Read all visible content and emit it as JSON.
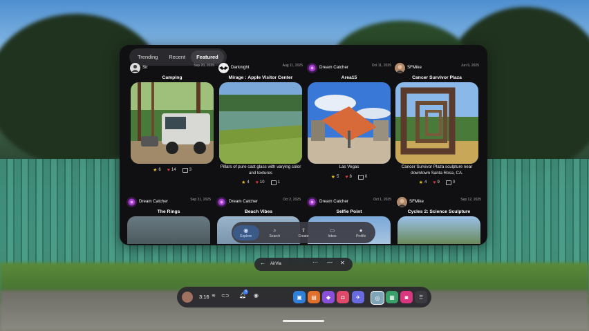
{
  "tabs": [
    {
      "label": "Trending"
    },
    {
      "label": "Recent"
    },
    {
      "label": "Featured"
    }
  ],
  "posts": [
    {
      "user": "Sir",
      "date": "Sep 20, 2025",
      "title": "Camping",
      "caption": "",
      "stars": "6",
      "likes": "14",
      "comments": "3"
    },
    {
      "user": "Darknight",
      "date": "Aug 11, 2025",
      "title": "Mirage : Apple Visitor Center",
      "caption": "Pillars of pure cast glass with varying color and textures",
      "stars": "4",
      "likes": "10",
      "comments": "1"
    },
    {
      "user": "Dream Catcher",
      "date": "Oct 11, 2025",
      "title": "Area15",
      "caption": "Las Vegas",
      "stars": "5",
      "likes": "8",
      "comments": "0"
    },
    {
      "user": "SFMike",
      "date": "Jun 9, 2025",
      "title": "Cancer Survivor Plaza",
      "caption": "Cancer Survivor Plaza sculpture near downtown Santa Rosa, CA.",
      "stars": "4",
      "likes": "9",
      "comments": "0"
    },
    {
      "user": "Dream Catcher",
      "date": "Sep 21, 2025",
      "title": "The Rings"
    },
    {
      "user": "Dream Catcher",
      "date": "Oct 2, 2025",
      "title": "Beach Vibes"
    },
    {
      "user": "Dream Catcher",
      "date": "Oct 1, 2025",
      "title": "Selfie Point"
    },
    {
      "user": "SFMike",
      "date": "Sep 12, 2025",
      "title": "Cycles 2: Science Sculpture"
    }
  ],
  "bottom_nav": [
    {
      "label": "Explore",
      "icon": "compass-icon"
    },
    {
      "label": "Search",
      "icon": "search-icon"
    },
    {
      "label": "Create",
      "icon": "share-icon"
    },
    {
      "label": "Inbox",
      "icon": "inbox-icon"
    },
    {
      "label": "Profile",
      "icon": "person-icon"
    }
  ],
  "titlebar": {
    "app_name": "AirVia"
  },
  "taskbar": {
    "time": "3:16",
    "notification_count": "3",
    "apps": [
      {
        "icon": "gallery-icon",
        "color": "#2f7fd6"
      },
      {
        "icon": "store-icon",
        "color": "#e0702a"
      },
      {
        "icon": "chat-icon",
        "color": "#8a4fd8"
      },
      {
        "icon": "camera-icon",
        "color": "#e04a6a"
      },
      {
        "icon": "messenger-icon",
        "color": "#6a6ae0"
      },
      {
        "icon": "airvia-icon",
        "color": "#7fa6b8"
      },
      {
        "icon": "files-icon",
        "color": "#3aa06a"
      },
      {
        "icon": "instagram-icon",
        "color": "#d8367e"
      },
      {
        "icon": "apps-grid-icon",
        "color": "#3a3a40"
      }
    ]
  },
  "colors": {
    "accent": "#3c5a88",
    "star": "#e5c21e",
    "heart": "#e23a3a"
  }
}
